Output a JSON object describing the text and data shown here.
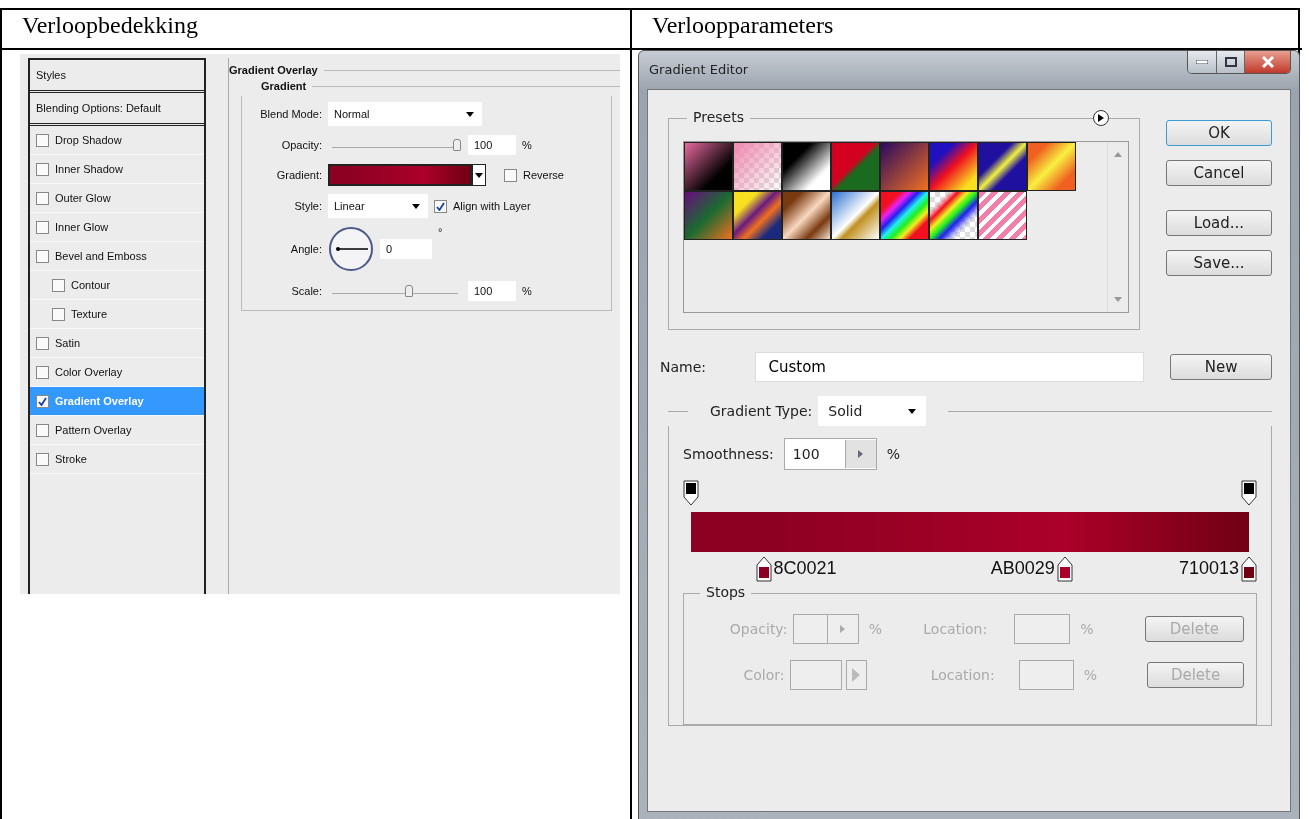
{
  "doc_table": {
    "headers": [
      "Verloopbedekking",
      "Verloopparameters"
    ]
  },
  "layer_style": {
    "styles_header": "Styles",
    "blending_options": "Blending Options: Default",
    "items": [
      {
        "label": "Drop Shadow",
        "checked": false,
        "selected": false
      },
      {
        "label": "Inner Shadow",
        "checked": false,
        "selected": false
      },
      {
        "label": "Outer Glow",
        "checked": false,
        "selected": false
      },
      {
        "label": "Inner Glow",
        "checked": false,
        "selected": false
      },
      {
        "label": "Bevel and Emboss",
        "checked": false,
        "selected": false,
        "children": [
          {
            "label": "Contour",
            "checked": false,
            "selected": false
          },
          {
            "label": "Texture",
            "checked": false,
            "selected": false
          }
        ]
      },
      {
        "label": "Satin",
        "checked": false,
        "selected": false
      },
      {
        "label": "Color Overlay",
        "checked": false,
        "selected": false
      },
      {
        "label": "Gradient Overlay",
        "checked": true,
        "selected": true
      },
      {
        "label": "Pattern Overlay",
        "checked": false,
        "selected": false
      },
      {
        "label": "Stroke",
        "checked": false,
        "selected": false
      }
    ],
    "section_title": "Gradient Overlay",
    "group_title": "Gradient",
    "blend_mode": {
      "label": "Blend Mode:",
      "value": "Normal"
    },
    "opacity": {
      "label": "Opacity:",
      "level": 1,
      "value": "100",
      "unit": "%"
    },
    "gradient": {
      "label": "Gradient:"
    },
    "reverse": {
      "label": "Reverse",
      "checked": false
    },
    "style": {
      "label": "Style:",
      "value": "Linear"
    },
    "align": {
      "label": "Align with Layer",
      "checked": true
    },
    "angle": {
      "label": "Angle:",
      "value": "0",
      "unit": "°"
    },
    "scale": {
      "label": "Scale:",
      "level": 0.62,
      "value": "100",
      "unit": "%"
    }
  },
  "gradient_editor": {
    "title": "Gradient Editor",
    "presets_label": "Presets",
    "buttons": [
      "OK",
      "Cancel",
      "Load...",
      "Save..."
    ],
    "name": {
      "label": "Name:",
      "value": "Custom"
    },
    "new_button": "New",
    "gradient_type": {
      "label": "Gradient Type:",
      "value": "Solid"
    },
    "smoothness": {
      "label": "Smoothness:",
      "value": "100",
      "unit": "%"
    },
    "color_stops": [
      {
        "label": "8C0021",
        "color": "#8c0021",
        "level": 0.13,
        "kind": "after"
      },
      {
        "label": "AB0029",
        "color": "#ab0029",
        "level": 0.67,
        "kind": "before"
      },
      {
        "label": "710013",
        "color": "#710013",
        "level": 1,
        "kind": "before"
      }
    ],
    "stops": {
      "title": "Stops",
      "disabled": true,
      "rows": [
        {
          "label": "Opacity:",
          "unit": "%",
          "location_label": "Location:",
          "location_unit": "%",
          "button": "Delete"
        },
        {
          "label": "Color:",
          "unit": "",
          "location_label": "Location:",
          "location_unit": "%",
          "button": "Delete"
        }
      ]
    }
  }
}
